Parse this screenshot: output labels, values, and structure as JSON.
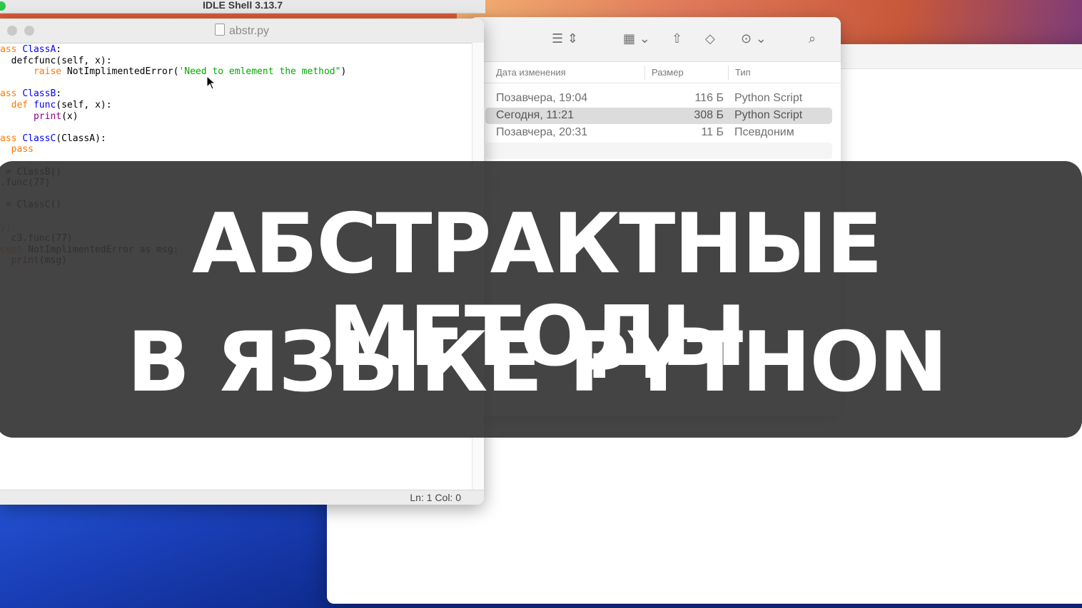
{
  "idle_shell": {
    "title": "IDLE Shell 3.13.7"
  },
  "editor": {
    "filename": "abstr.py",
    "code_lines": [
      [
        {
          "t": "ass ",
          "c": "kw"
        },
        {
          "t": "ClassA",
          "c": "def"
        },
        {
          "t": ":",
          "c": ""
        }
      ],
      [
        {
          "t": "  defcfunc(self, x):",
          "c": ""
        }
      ],
      [
        {
          "t": "      ",
          "c": ""
        },
        {
          "t": "raise",
          "c": "kw"
        },
        {
          "t": " NotImplimentedError(",
          "c": ""
        },
        {
          "t": "'Need to emlement the method\"",
          "c": "str"
        },
        {
          "t": ")",
          "c": ""
        }
      ],
      [
        {
          "t": "",
          "c": ""
        }
      ],
      [
        {
          "t": "ass ",
          "c": "kw"
        },
        {
          "t": "ClassB",
          "c": "def"
        },
        {
          "t": ":",
          "c": ""
        }
      ],
      [
        {
          "t": "  ",
          "c": ""
        },
        {
          "t": "def ",
          "c": "kw"
        },
        {
          "t": "func",
          "c": "def"
        },
        {
          "t": "(self, x):",
          "c": ""
        }
      ],
      [
        {
          "t": "      ",
          "c": ""
        },
        {
          "t": "print",
          "c": "bi"
        },
        {
          "t": "(x)",
          "c": ""
        }
      ],
      [
        {
          "t": "",
          "c": ""
        }
      ],
      [
        {
          "t": "ass ",
          "c": "kw"
        },
        {
          "t": "ClassC",
          "c": "def"
        },
        {
          "t": "(ClassA):",
          "c": ""
        }
      ],
      [
        {
          "t": "  ",
          "c": ""
        },
        {
          "t": "pass",
          "c": "kw"
        }
      ],
      [
        {
          "t": "",
          "c": ""
        }
      ],
      [
        {
          "t": " = ClassB()",
          "c": ""
        }
      ],
      [
        {
          "t": ".func(77)",
          "c": ""
        }
      ],
      [
        {
          "t": "",
          "c": ""
        }
      ],
      [
        {
          "t": " = ClassC()",
          "c": ""
        }
      ],
      [
        {
          "t": "",
          "c": ""
        }
      ],
      [
        {
          "t": "y:",
          "c": "kw"
        }
      ],
      [
        {
          "t": "  c3.",
          "c": ""
        },
        {
          "t": "func",
          "c": ""
        },
        {
          "t": "(77)",
          "c": ""
        }
      ],
      [
        {
          "t": "cept",
          "c": "kw"
        },
        {
          "t": " NotImplimentedError as msg:",
          "c": ""
        }
      ],
      [
        {
          "t": "  ",
          "c": ""
        },
        {
          "t": "print",
          "c": "bi"
        },
        {
          "t": "(msg)",
          "c": ""
        }
      ]
    ],
    "status": "Ln: 1  Col: 0"
  },
  "finder": {
    "headers": {
      "date": "Дата изменения",
      "size": "Размер",
      "kind": "Тип"
    },
    "rows": [
      {
        "date": "Позавчера, 19:04",
        "size": "116 Б",
        "kind": "Python Script",
        "selected": false
      },
      {
        "date": "Сегодня, 11:21",
        "size": "308 Б",
        "kind": "Python Script",
        "selected": true
      },
      {
        "date": "Позавчера, 20:31",
        "size": "11 Б",
        "kind": "Псевдоним",
        "selected": false
      }
    ],
    "toolbar_icons": [
      "list-view-icon",
      "grid-view-icon",
      "share-icon",
      "tag-icon",
      "more-icon",
      "search-icon"
    ]
  },
  "banner": {
    "line1": "АБСТРАКТНЫЕ МЕТОДЫ",
    "line2": "В ЯЗЫКЕ PYTHON"
  }
}
